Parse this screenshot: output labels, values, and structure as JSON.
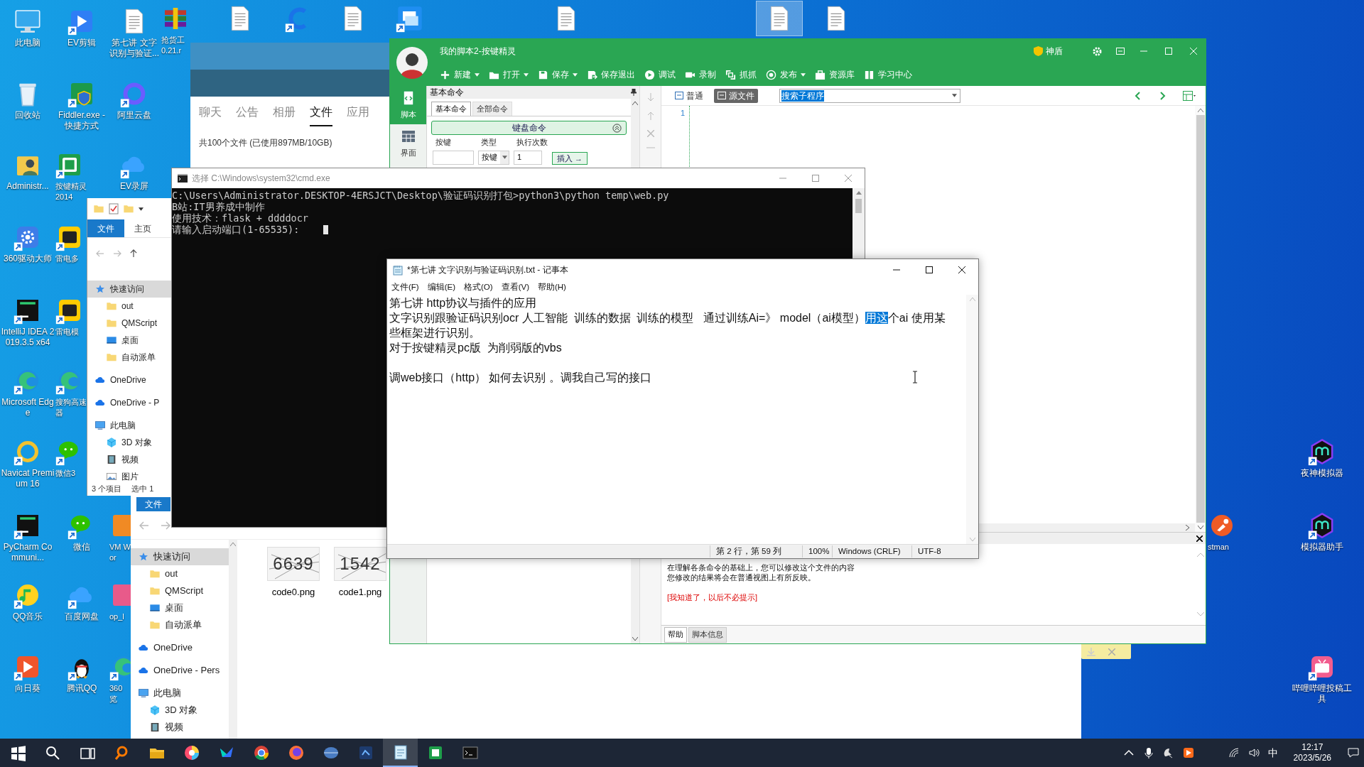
{
  "desktop": {
    "columns": [
      [
        {
          "label": "此电脑",
          "kind": "pc"
        },
        {
          "label": "回收站",
          "kind": "bin"
        },
        {
          "label": "Administr...",
          "kind": "user"
        },
        {
          "label": "360驱动大师",
          "kind": "gear"
        },
        {
          "label": "IntelliJ IDEA 2019.3.5 x64",
          "kind": "tile-dark"
        },
        {
          "label": "Microsoft Edge",
          "kind": "swirl"
        },
        {
          "label": "Navicat Premium 16",
          "kind": "ring-yellow"
        },
        {
          "label": "PyCharm Communi...",
          "kind": "tile-dark"
        },
        {
          "label": "QQ音乐",
          "kind": "note"
        },
        {
          "label": "向日葵",
          "kind": "play-orange"
        }
      ],
      [
        {
          "label": "EV剪辑",
          "kind": "play"
        },
        {
          "label": "Fiddler.exe - 快捷方式",
          "kind": "shield"
        },
        {
          "label": "按键精灵 2014",
          "kind": "tile-green"
        },
        {
          "label": "雷电多",
          "kind": "tile-yellow"
        },
        {
          "label": "雷电模",
          "kind": "tile-yellow"
        },
        {
          "label": "搜狗高速器",
          "kind": "swirl"
        },
        {
          "label": "微信3",
          "kind": "chat"
        },
        {
          "label": "微信",
          "kind": "chat"
        },
        {
          "label": "百度网盘",
          "kind": "cloud"
        },
        {
          "label": "腾讯QQ",
          "kind": "penguin"
        }
      ],
      [
        {
          "label": "第七讲 文字识别与验证...",
          "kind": "doc"
        },
        {
          "label": "阿里云盘",
          "kind": "ring"
        },
        {
          "label": "EV录屏",
          "kind": "cloud"
        },
        {
          "label": "VM Wor",
          "kind": "tile-orange"
        },
        {
          "label": "op_l",
          "kind": "tile-pink"
        },
        {
          "label": "360 览",
          "kind": "swirl"
        }
      ]
    ],
    "top_row": [
      {
        "label": "抢货工 0.21.r",
        "kind": "books",
        "selected": false
      },
      {
        "kind": "doc",
        "selected": false
      },
      {
        "kind": "ring-blue",
        "selected": false
      },
      {
        "kind": "doc",
        "selected": false
      },
      {
        "kind": "window",
        "selected": false
      },
      {
        "kind": "doc",
        "selected": false
      },
      {
        "kind": "doc",
        "selected": true
      },
      {
        "kind": "doc",
        "selected": false
      }
    ],
    "right": [
      {
        "label": "stman",
        "kind": "postman"
      },
      {
        "label": "夜神模拟器",
        "kind": "nox"
      },
      {
        "label": "模拟器助手",
        "kind": "nox"
      },
      {
        "label": "哔哩哔哩投稿工具",
        "kind": "bili"
      }
    ]
  },
  "chat_window": {
    "tabs": [
      {
        "label": "聊天",
        "selected": false
      },
      {
        "label": "公告",
        "selected": false
      },
      {
        "label": "相册",
        "selected": false
      },
      {
        "label": "文件",
        "selected": true
      },
      {
        "label": "应用",
        "selected": false
      }
    ],
    "file_summary": "共100个文件 (已使用897MB/10GB)"
  },
  "explorer_small": {
    "ribbon_tabs": [
      {
        "label": "文件",
        "selected": true
      },
      {
        "label": "主页",
        "selected": false
      }
    ],
    "nav": [
      {
        "label": "快速访问",
        "kind": "star",
        "selected": true,
        "children": [
          {
            "label": "out",
            "kind": "folder",
            "selected": false
          },
          {
            "label": "QMScript",
            "kind": "folder",
            "selected": false
          },
          {
            "label": "桌面",
            "kind": "desktop",
            "selected": false
          },
          {
            "label": "自动派单",
            "kind": "folder",
            "selected": false
          }
        ]
      },
      {
        "label": "OneDrive",
        "kind": "onedrive",
        "selected": false
      },
      {
        "label": "OneDrive - P",
        "kind": "onedrive",
        "selected": false
      },
      {
        "label": "此电脑",
        "kind": "thispc",
        "selected": false,
        "children": [
          {
            "label": "3D 对象",
            "kind": "cube",
            "selected": false
          },
          {
            "label": "视频",
            "kind": "film",
            "selected": false
          },
          {
            "label": "图片",
            "kind": "image",
            "selected": false
          }
        ]
      }
    ],
    "status": [
      "3 个项目",
      "选中 1"
    ]
  },
  "explorer_large": {
    "ribbon_tab": "文件",
    "nav": [
      {
        "label": "快速访问",
        "kind": "star",
        "selected": true,
        "children": [
          {
            "label": "out",
            "kind": "folder",
            "selected": false
          },
          {
            "label": "QMScript",
            "kind": "folder",
            "selected": false
          },
          {
            "label": "桌面",
            "kind": "desktop",
            "selected": false
          },
          {
            "label": "自动派单",
            "kind": "folder",
            "selected": false
          }
        ]
      },
      {
        "label": "OneDrive",
        "kind": "onedrive",
        "selected": false
      },
      {
        "label": "OneDrive - Pers",
        "kind": "onedrive",
        "selected": false
      },
      {
        "label": "此电脑",
        "kind": "thispc",
        "selected": false,
        "children": [
          {
            "label": "3D 对象",
            "kind": "cube",
            "selected": false
          },
          {
            "label": "视频",
            "kind": "film",
            "selected": false
          }
        ]
      }
    ],
    "files": [
      {
        "name": "code0.png",
        "thumbnail_text": "6639"
      },
      {
        "name": "code1.png",
        "thumbnail_text": "1542"
      }
    ]
  },
  "key_wizard": {
    "title": "我的脚本2-按键精灵",
    "badge": "神盾",
    "toolbar": [
      {
        "label": "新建",
        "kind": "plus",
        "dropdown": true
      },
      {
        "label": "打开",
        "kind": "folder",
        "dropdown": true
      },
      {
        "label": "保存",
        "kind": "save",
        "dropdown": true
      },
      {
        "label": "保存退出",
        "kind": "save-exit",
        "dropdown": false
      },
      {
        "label": "调试",
        "kind": "play",
        "dropdown": false
      },
      {
        "label": "录制",
        "kind": "camera",
        "dropdown": false
      },
      {
        "label": "抓抓",
        "kind": "capture",
        "dropdown": false
      },
      {
        "label": "发布",
        "kind": "target",
        "dropdown": true
      },
      {
        "label": "资源库",
        "kind": "box",
        "dropdown": false
      },
      {
        "label": "学习中心",
        "kind": "book",
        "dropdown": false
      }
    ],
    "sidebar": [
      {
        "label": "脚本",
        "kind": "script",
        "selected": true
      },
      {
        "label": "界面",
        "kind": "grid",
        "selected": false
      }
    ],
    "command_panel": {
      "title": "基本命令",
      "tabs": [
        {
          "label": "基本命令",
          "selected": true
        },
        {
          "label": "全部命令",
          "selected": false
        }
      ],
      "section": "键盘命令",
      "fields": [
        {
          "label": "按键",
          "kind": "text"
        },
        {
          "label": "类型",
          "kind": "select",
          "value": "按键"
        },
        {
          "label": "执行次数",
          "kind": "text",
          "value": "1"
        }
      ],
      "insert_button": "插入 →"
    },
    "editor": {
      "view_tabs": [
        {
          "label": "普通",
          "selected": false
        },
        {
          "label": "源文件",
          "selected": true
        }
      ],
      "search_value": "搜索子程序",
      "line_numbers": [
        "1"
      ]
    },
    "help": {
      "lines": [
        "在理解各条命令的基础上，您可以修改这个文件的内容",
        "您修改的结果将会在普通视图上有所反映。"
      ],
      "dismiss_link": "[我知道了，以后不必提示]",
      "tabs": [
        {
          "label": "帮助",
          "selected": true
        },
        {
          "label": "脚本信息",
          "selected": false
        }
      ]
    }
  },
  "cmd": {
    "title": "选择 C:\\Windows\\system32\\cmd.exe",
    "lines": [
      "C:\\Users\\Administrator.DESKTOP-4ERSJCT\\Desktop\\验证码识别打包>python3\\python temp\\web.py",
      "B站:IT男养成中制作",
      "使用技术：flask + ddddocr",
      "请输入启动端口(1-65535):"
    ]
  },
  "notepad": {
    "title": "*第七讲 文字识别与验证码识别.txt - 记事本",
    "menu": [
      "文件(F)",
      "编辑(E)",
      "格式(O)",
      "查看(V)",
      "帮助(H)"
    ],
    "paragraphs": [
      {
        "segments": [
          {
            "text": "第七讲 http协议与插件的应用",
            "selected": false
          }
        ]
      },
      {
        "segments": [
          {
            "text": "文字识别跟验证码识别ocr 人工智能  训练的数据  训练的模型   通过训练Ai=》 model（ai模型）",
            "selected": false
          },
          {
            "text": "用这",
            "selected": true
          },
          {
            "text": "个ai 使用某些框架进行识别。",
            "selected": false
          }
        ]
      },
      {
        "segments": [
          {
            "text": "对于按键精灵pc版  为削弱版的vbs",
            "selected": false
          }
        ]
      },
      {
        "kind": "blank"
      },
      {
        "segments": [
          {
            "text": "调web接口（http） 如何去识别 。调我自己写的接口",
            "selected": false
          }
        ]
      }
    ],
    "status": [
      "第 2 行，第 59 列",
      "100%",
      "Windows (CRLF)",
      "UTF-8"
    ]
  },
  "taskbar": {
    "items": [
      {
        "kind": "start",
        "selected": false
      },
      {
        "kind": "search",
        "selected": false
      },
      {
        "kind": "taskview",
        "selected": false
      },
      {
        "kind": "lens",
        "selected": false
      },
      {
        "kind": "folder",
        "selected": false
      },
      {
        "kind": "wheel",
        "selected": false
      },
      {
        "kind": "bird",
        "selected": false
      },
      {
        "kind": "browser",
        "selected": false
      },
      {
        "kind": "fox",
        "selected": false
      },
      {
        "kind": "globe",
        "selected": false
      },
      {
        "kind": "dark",
        "selected": false
      },
      {
        "kind": "notepad",
        "selected": true
      },
      {
        "kind": "wizard",
        "selected": false
      },
      {
        "kind": "terminal",
        "selected": false
      }
    ],
    "ime": "中",
    "time": "12:17",
    "date": "2023/5/26"
  }
}
